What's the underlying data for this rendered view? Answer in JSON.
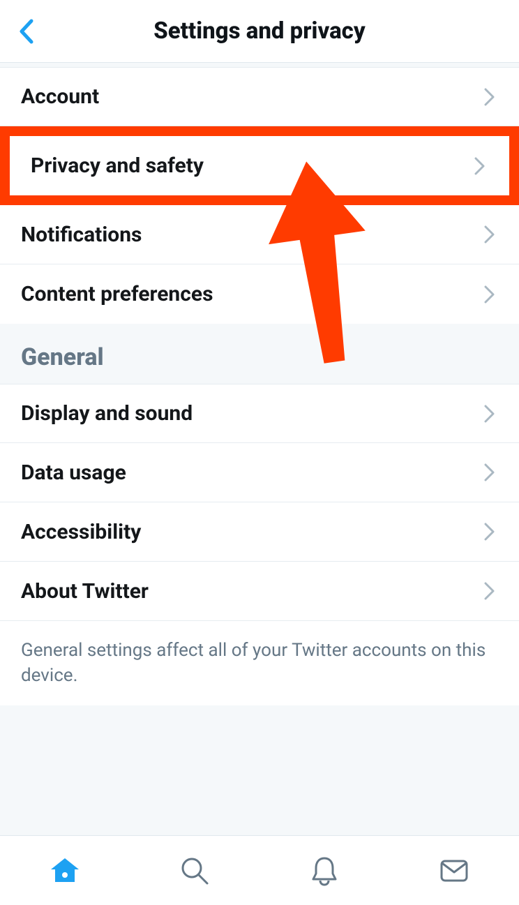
{
  "header": {
    "title": "Settings and privacy"
  },
  "top_section": {
    "items": [
      {
        "label": "Account"
      },
      {
        "label": "Privacy and safety",
        "highlighted": true
      },
      {
        "label": "Notifications"
      },
      {
        "label": "Content preferences"
      }
    ]
  },
  "general_section": {
    "title": "General",
    "items": [
      {
        "label": "Display and sound"
      },
      {
        "label": "Data usage"
      },
      {
        "label": "Accessibility"
      },
      {
        "label": "About Twitter"
      }
    ],
    "footer": "General settings affect all of your Twitter accounts on this device."
  },
  "tabbar": {
    "items": [
      {
        "name": "home",
        "active": true
      },
      {
        "name": "search",
        "active": false
      },
      {
        "name": "notifications",
        "active": false
      },
      {
        "name": "messages",
        "active": false
      }
    ]
  },
  "colors": {
    "highlight": "#ff3b00",
    "accent": "#1da1f2",
    "text_muted": "#657786"
  }
}
